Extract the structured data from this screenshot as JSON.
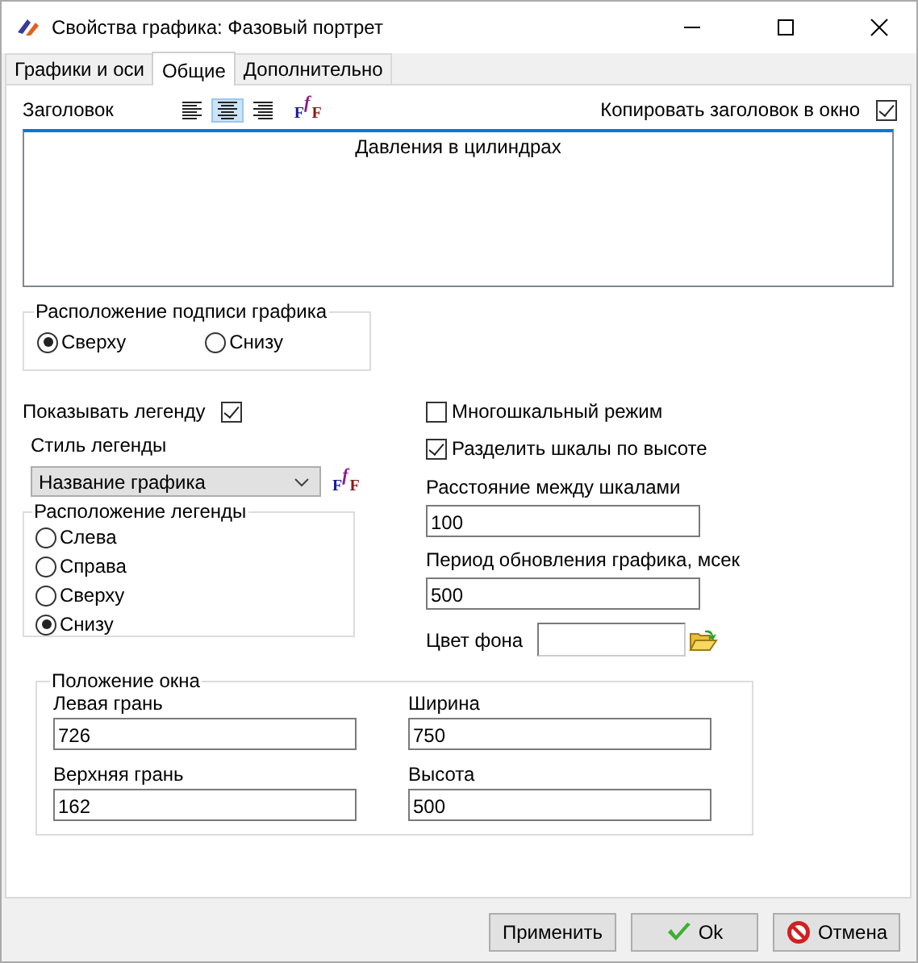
{
  "window": {
    "title": "Свойства графика: Фазовый портрет"
  },
  "tabs": [
    {
      "label": "Графики и оси",
      "selected": false
    },
    {
      "label": "Общие",
      "selected": true
    },
    {
      "label": "Дополнительно",
      "selected": false
    }
  ],
  "title_section": {
    "label": "Заголовок",
    "align_buttons": [
      {
        "kind": "left",
        "selected": false
      },
      {
        "kind": "center",
        "selected": true
      },
      {
        "kind": "right",
        "selected": false
      }
    ],
    "font_glyphs": [
      "F",
      "f",
      "F"
    ],
    "copy_title": {
      "label": "Копировать заголовок в окно",
      "checked": true
    },
    "text": "Давления в цилиндрах"
  },
  "caption_position": {
    "legend": "Расположение подписи графика",
    "options": [
      {
        "label": "Сверху",
        "selected": true
      },
      {
        "label": "Снизу",
        "selected": false
      }
    ]
  },
  "show_legend": {
    "label": "Показывать легенду",
    "checked": true
  },
  "legend_style": {
    "label": "Стиль легенды",
    "value": "Название графика",
    "font_glyphs": [
      "F",
      "f",
      "F"
    ]
  },
  "legend_position": {
    "legend": "Расположение легенды",
    "options": [
      {
        "label": "Слева",
        "selected": false
      },
      {
        "label": "Справа",
        "selected": false
      },
      {
        "label": "Сверху",
        "selected": false
      },
      {
        "label": "Снизу",
        "selected": true
      }
    ]
  },
  "multiscale": {
    "label": "Многошкальный режим",
    "checked": false
  },
  "split_scales": {
    "label": "Разделить шкалы по высоте",
    "checked": true
  },
  "scale_distance": {
    "label": "Расстояние между шкалами",
    "value": "100"
  },
  "update_period": {
    "label": "Период обновления графика, мсек",
    "value": "500"
  },
  "background_color": {
    "label": "Цвет фона"
  },
  "window_position": {
    "legend": "Положение окна",
    "fields": [
      {
        "label": "Левая грань",
        "value": "726"
      },
      {
        "label": "Ширина",
        "value": "750"
      },
      {
        "label": "Верхняя грань",
        "value": "162"
      },
      {
        "label": "Высота",
        "value": "500"
      }
    ]
  },
  "buttons": [
    {
      "label": "Применить",
      "kind": "apply"
    },
    {
      "label": "Ok",
      "kind": "ok"
    },
    {
      "label": "Отмена",
      "kind": "cancel"
    }
  ]
}
